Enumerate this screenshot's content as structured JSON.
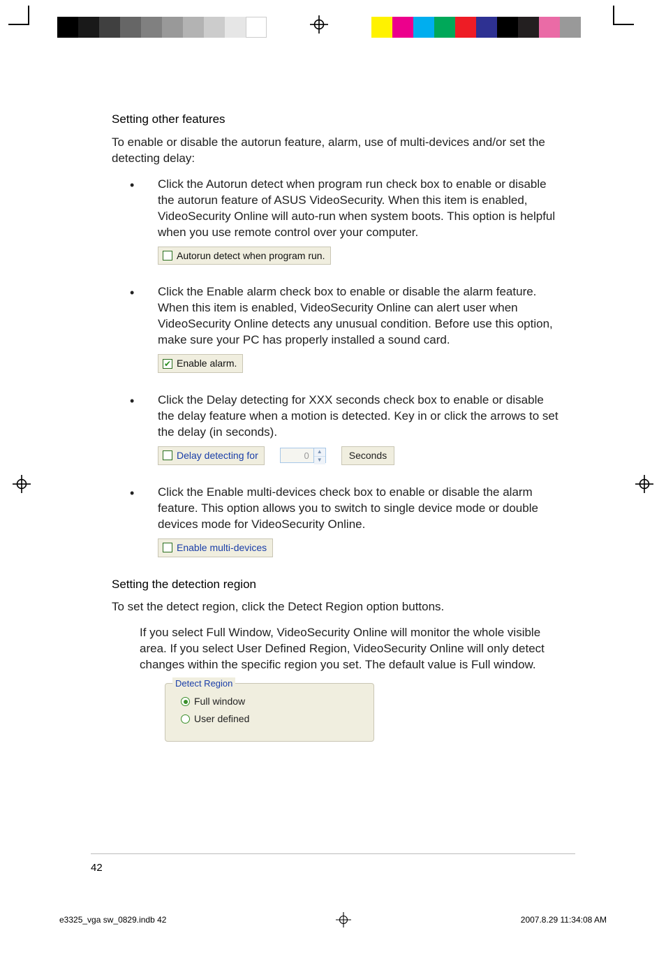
{
  "headings": {
    "other_features": "Setting other features",
    "detection_region": "Setting the detection region"
  },
  "intros": {
    "other_features": "To enable or disable the autorun feature, alarm, use of multi-devices and/or set the detecting delay:",
    "detection_region": "To set the detect region, click the Detect Region option buttons."
  },
  "bullets": {
    "autorun": "Click the Autorun detect when program run check box to enable or disable the autorun feature of ASUS VideoSecurity. When this item is enabled, VideoSecurity Online will auto-run when system boots. This option is helpful when you use remote control over your computer.",
    "alarm": "Click the Enable alarm check box to enable or disable the alarm feature. When this item is enabled, VideoSecurity Online can alert user when VideoSecurity Online detects any unusual condition. Before use this option, make sure your PC has properly installed a sound card.",
    "delay": "Click the Delay detecting for XXX seconds check box to enable or disable the delay feature when a motion is detected. Key in or click the arrows to set the delay (in seconds).",
    "multi": "Click the Enable multi-devices check box to enable or disable the alarm feature. This option allows you to switch to single device mode or double devices mode for VideoSecurity Online."
  },
  "detection_para": "If you select Full Window, VideoSecurity Online will monitor the whole visible area. If you select User Defined Region, VideoSecurity Online will only detect changes within the specific region you set. The default value is Full window.",
  "ui": {
    "autorun_label": "Autorun detect when program run.",
    "alarm_label": "Enable alarm.",
    "delay_label": "Delay detecting for",
    "delay_value": "0",
    "seconds_label": "Seconds",
    "multi_label": "Enable multi-devices",
    "detect_region_legend": "Detect Region",
    "radio_full": "Full window",
    "radio_user": "User defined"
  },
  "footer": {
    "page_number": "42",
    "file": "e3325_vga sw_0829.indb   42",
    "date": "2007.8.29   11:34:08 AM"
  }
}
